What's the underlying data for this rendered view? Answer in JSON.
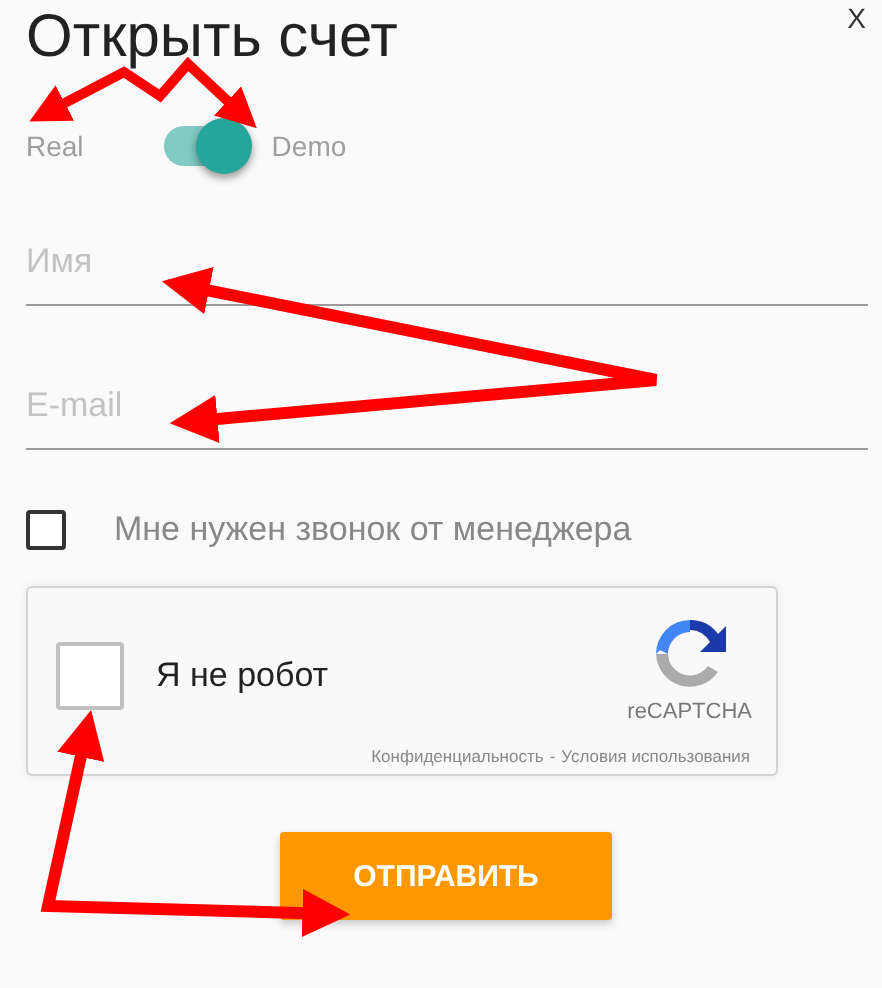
{
  "title": "Открыть счет",
  "close": "X",
  "account_toggle": {
    "left_label": "Real",
    "right_label": "Demo",
    "on": true
  },
  "fields": [
    {
      "placeholder": "Имя"
    },
    {
      "placeholder": "E-mail"
    }
  ],
  "callback": {
    "label": "Мне нужен звонок от менеджера",
    "checked": false
  },
  "captcha": {
    "label": "Я не робот",
    "checked": false,
    "brand": "reCAPTCHA",
    "links": [
      "Конфиденциальность",
      "Условия использования"
    ],
    "separator": "-"
  },
  "submit": "ОТПРАВИТЬ"
}
